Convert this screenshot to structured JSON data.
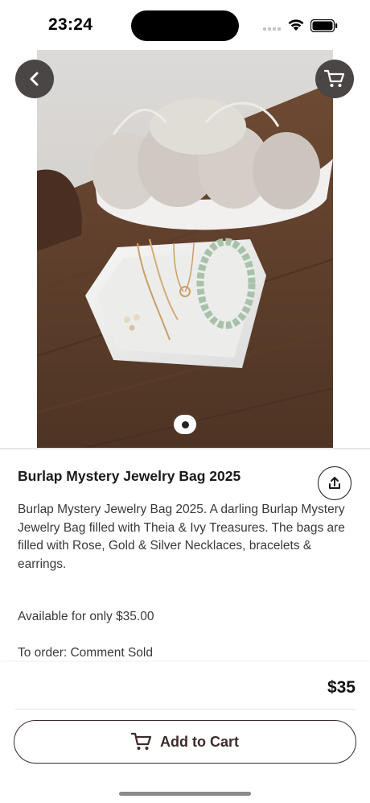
{
  "status_bar": {
    "time": "23:24",
    "icons": [
      "signal-icon",
      "wifi-icon",
      "battery-icon"
    ]
  },
  "hero": {
    "icons": {
      "back": "chevron-left-icon",
      "cart": "cart-icon"
    },
    "image_pages": 1,
    "active_page": 1
  },
  "product": {
    "title": "Burlap Mystery Jewelry Bag 2025",
    "description": "Burlap Mystery Jewelry Bag 2025. A darling Burlap Mystery Jewelry Bag filled with Theia & Ivy Treasures. The bags are filled with Rose, Gold & Silver Necklaces, bracelets & earrings.",
    "availability": "Available for only $35.00",
    "order_info": "To order: Comment Sold",
    "share_icon": "share-icon"
  },
  "purchase": {
    "price": "$35",
    "add_to_cart_label": "Add to Cart",
    "button_icon": "cart-icon"
  },
  "colors": {
    "nav_button": "#4a4645",
    "button_border": "#3b2a2a",
    "text_primary": "#1a1a1a",
    "text_secondary": "#3a3a3c"
  }
}
